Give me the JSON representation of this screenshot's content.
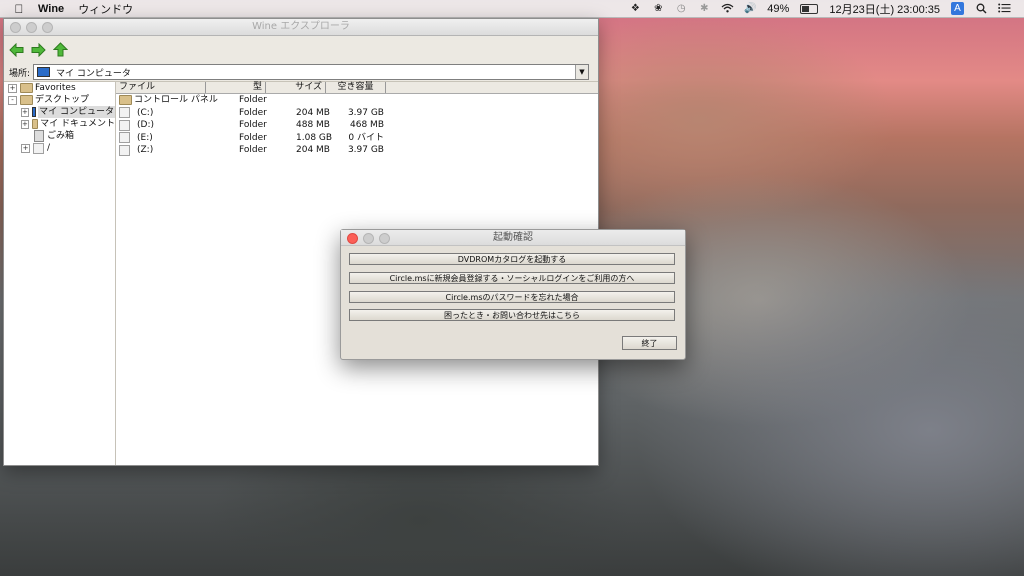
{
  "menubar": {
    "app_name": "Wine",
    "menus": [
      "ウィンドウ"
    ],
    "battery": {
      "percent_label": "49%",
      "level": 0.49
    },
    "datetime": "12月23日(土) 23:00:35",
    "input_badge": "A",
    "icons": [
      "apple-icon",
      "dropbox-icon",
      "evernote-icon",
      "time-machine-icon",
      "bluetooth-icon",
      "wifi-icon",
      "volume-icon",
      "battery-icon",
      "search-icon",
      "notification-center-icon"
    ]
  },
  "explorer": {
    "title": "Wine エクスプローラ",
    "address_label": "場所:",
    "address_value": "マイ コンピュータ",
    "tree": [
      {
        "label": "Favorites",
        "expander": "+",
        "icon": "folder"
      },
      {
        "label": "デスクトップ",
        "expander": "-",
        "icon": "folder"
      },
      {
        "label": "マイ コンピュータ",
        "expander": "+",
        "icon": "pc",
        "selected": true
      },
      {
        "label": "マイ ドキュメント",
        "expander": "+",
        "icon": "folder"
      },
      {
        "label": "ごみ箱",
        "expander": "",
        "icon": "trash"
      },
      {
        "label": "/",
        "expander": "+",
        "icon": "drive"
      }
    ],
    "columns": {
      "name": "ファイル",
      "type": "型",
      "size": "サイズ",
      "free": "空き容量"
    },
    "rows": [
      {
        "name": "コントロール パネル",
        "type": "Folder",
        "size": "",
        "free": "",
        "icon": "folder"
      },
      {
        "name": "(C:)",
        "type": "Folder",
        "size": "204 MB",
        "free": "3.97 GB",
        "icon": "drive"
      },
      {
        "name": "(D:)",
        "type": "Folder",
        "size": "488 MB",
        "free": "468 MB",
        "icon": "drive"
      },
      {
        "name": "(E:)",
        "type": "Folder",
        "size": "1.08 GB",
        "free": "0 バイト",
        "icon": "drive"
      },
      {
        "name": "(Z:)",
        "type": "Folder",
        "size": "204 MB",
        "free": "3.97 GB",
        "icon": "drive"
      }
    ]
  },
  "dialog": {
    "title": "起動確認",
    "buttons": [
      "DVDROMカタログを起動する",
      "Circle.msに新規会員登録する・ソーシャルログインをご利用の方へ",
      "Circle.msのパスワードを忘れた場合",
      "困ったとき・お問い合わせ先はこちら"
    ],
    "close_label": "終了"
  }
}
